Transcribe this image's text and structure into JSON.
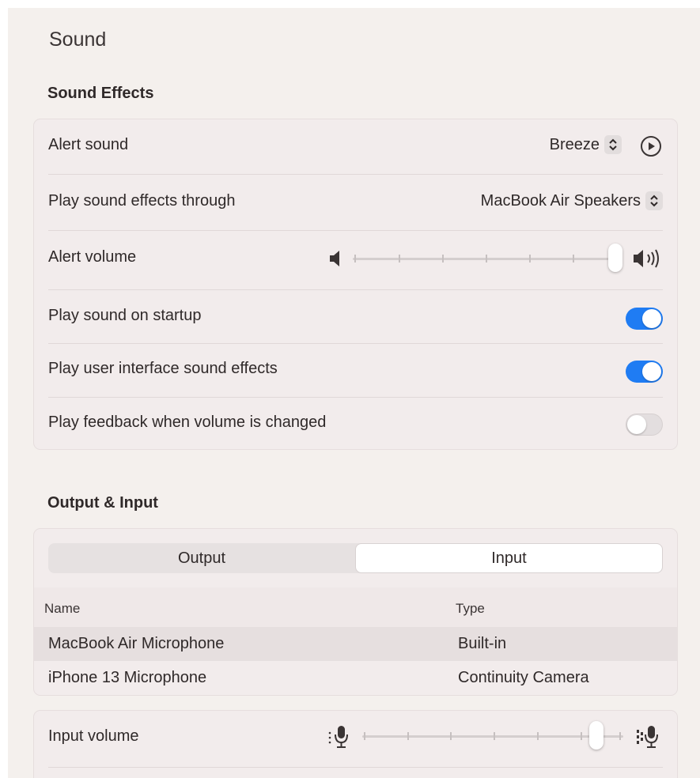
{
  "title": "Sound",
  "sound_effects": {
    "heading": "Sound Effects",
    "alert_sound": {
      "label": "Alert sound",
      "value": "Breeze"
    },
    "play_through": {
      "label": "Play sound effects through",
      "value": "MacBook Air Speakers"
    },
    "alert_volume": {
      "label": "Alert volume",
      "level": 0.95
    },
    "startup": {
      "label": "Play sound on startup",
      "on": true
    },
    "ui_sounds": {
      "label": "Play user interface sound effects",
      "on": true
    },
    "feedback": {
      "label": "Play feedback when volume is changed",
      "on": false
    }
  },
  "output_input": {
    "heading": "Output & Input",
    "tabs": [
      "Output",
      "Input"
    ],
    "selected_tab": "Input",
    "columns": [
      "Name",
      "Type"
    ],
    "devices": [
      {
        "name": "MacBook Air Microphone",
        "type": "Built-in",
        "selected": true
      },
      {
        "name": "iPhone 13 Microphone",
        "type": "Continuity Camera",
        "selected": false
      }
    ],
    "input_volume": {
      "label": "Input volume",
      "level": 0.88
    }
  },
  "colors": {
    "accent": "#1f7cf3",
    "window_bg": "#f4f0ed",
    "card_bg": "#f2ecec",
    "selected_row": "#e6dfdf"
  },
  "icons": [
    "chevron-up-down-icon",
    "play-circle-icon",
    "speaker-low-icon",
    "speaker-high-icon",
    "microphone-low-icon",
    "microphone-high-icon"
  ]
}
